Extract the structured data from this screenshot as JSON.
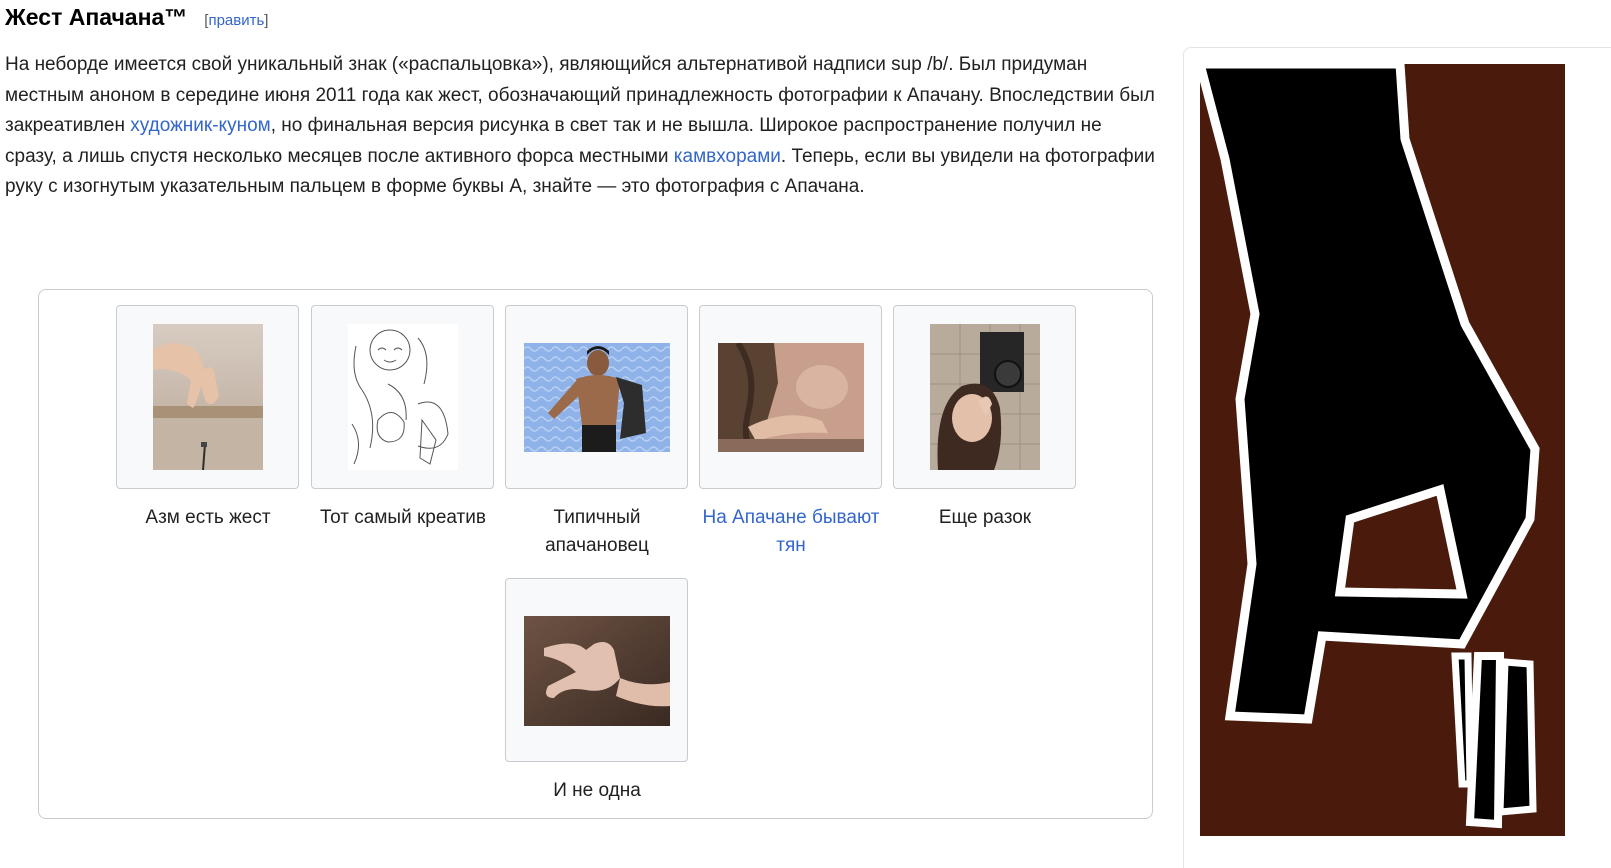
{
  "section": {
    "title": "Жест Апачана™",
    "edit_open": "[",
    "edit_label": "править",
    "edit_close": "]"
  },
  "intro": {
    "t1": "На неборде имеется свой уникальный знак («распальцовка»), являющийся альтернативой надписи sup /b/. Был придуман местным аноном в середине июня 2011 года как жест, обозначающий принадлежность фотографии к Апачану. Впоследствии был закреативлен ",
    "link1": "художник-куном",
    "t2": ", но финальная версия рисунка в свет так и не вышла. Широкое распространение получил не сразу, а лишь спустя несколько месяцев после активного форса местными ",
    "link2": "камвхорами",
    "t3": ". Теперь, если вы увидели на фотографии руку с изогнутым указательным пальцем в форме буквы А, знайте — это фотография с Апачана."
  },
  "gallery": {
    "items": [
      {
        "caption": "Азм есть жест",
        "is_link": false
      },
      {
        "caption": "Тот самый креатив",
        "is_link": false
      },
      {
        "caption": "Типичный апачановец",
        "is_link": false
      },
      {
        "caption": "На Апачане бывают тян",
        "is_link": true
      },
      {
        "caption": "Еще разок",
        "is_link": false
      },
      {
        "caption": "И не одна",
        "is_link": false
      }
    ]
  },
  "colors": {
    "link": "#3366cc",
    "text": "#202122",
    "border": "#c8ccd1",
    "side_background": "#4a1a0c"
  }
}
